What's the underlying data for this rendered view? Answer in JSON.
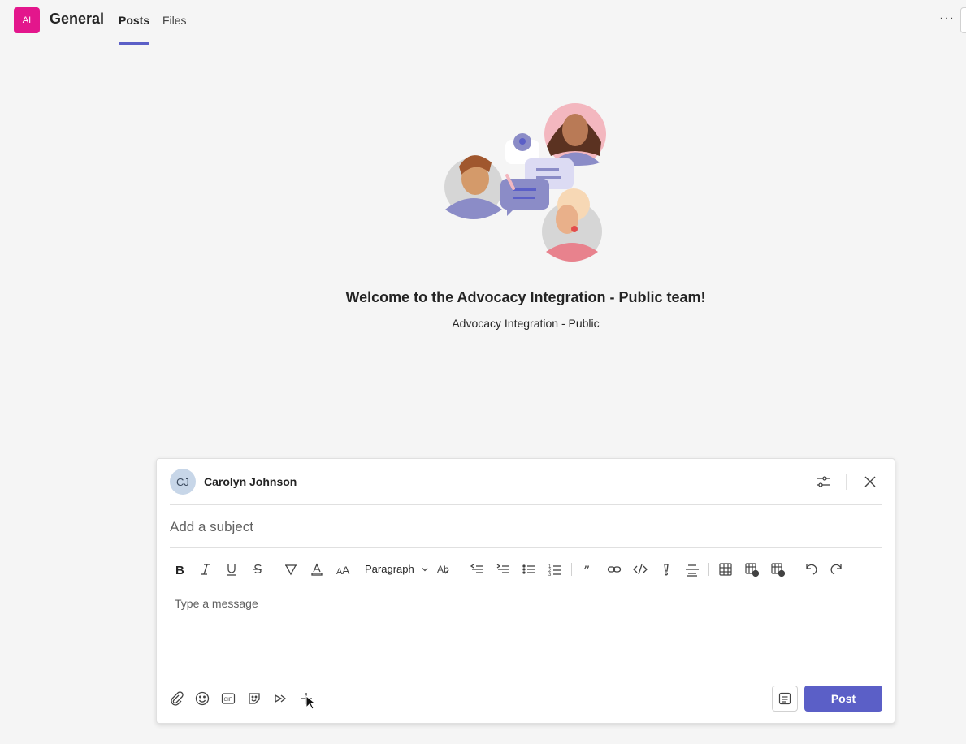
{
  "header": {
    "team_initials": "AI",
    "channel_title": "General",
    "tabs": [
      {
        "label": "Posts",
        "active": true
      },
      {
        "label": "Files",
        "active": false
      }
    ],
    "more_label": "···",
    "accent_color": "#5b5fc7",
    "team_color": "#e3168c"
  },
  "welcome": {
    "title": "Welcome to the Advocacy Integration - Public team!",
    "subtitle": "Advocacy Integration - Public"
  },
  "compose": {
    "author_initials": "CJ",
    "author_name": "Carolyn Johnson",
    "subject_placeholder": "Add a subject",
    "message_placeholder": "Type a message",
    "paragraph_label": "Paragraph",
    "post_label": "Post",
    "toolbar_icons": [
      "bold-icon",
      "italic-icon",
      "underline-icon",
      "strikethrough-icon",
      "highlight-icon",
      "font-color-icon",
      "font-size-icon",
      "paragraph-select",
      "clear-format-icon",
      "decrease-indent-icon",
      "increase-indent-icon",
      "bulleted-list-icon",
      "numbered-list-icon",
      "quote-icon",
      "link-icon",
      "code-icon",
      "important-icon",
      "horizontal-rule-icon",
      "insert-table-icon",
      "add-table-row-icon",
      "delete-table-icon",
      "undo-icon",
      "redo-icon"
    ],
    "bottom_icons": [
      "attach-icon",
      "emoji-icon",
      "gif-icon",
      "sticker-icon",
      "schedule-meeting-icon",
      "more-apps-icon"
    ]
  }
}
